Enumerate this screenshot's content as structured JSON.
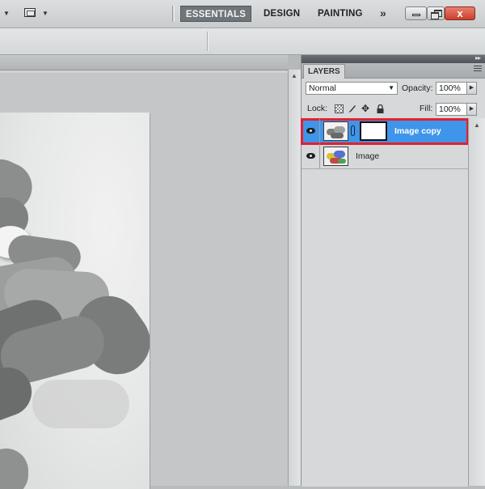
{
  "workspace": {
    "buttons": [
      "ESSENTIALS",
      "DESIGN",
      "PAINTING"
    ],
    "active": "ESSENTIALS",
    "more_symbol": "»"
  },
  "window_controls": {
    "close_symbol": "x"
  },
  "icons": {
    "tool_preset_arrow": "dropdown-arrow",
    "screen_mode": "screen-mode-icon",
    "lock_transparent": "checker-icon",
    "lock_pixels": "brush-icon",
    "lock_position": "move-icon",
    "lock_all": "padlock-icon",
    "visibility": "eye-icon",
    "mask_link": "chain-icon"
  },
  "layers_panel": {
    "tab_label": "LAYERS",
    "blend_mode": "Normal",
    "opacity_label": "Opacity:",
    "opacity_value": "100%",
    "lock_label": "Lock:",
    "fill_label": "Fill:",
    "fill_value": "100%",
    "layers": [
      {
        "name": "Image copy",
        "selected": true,
        "visible": true,
        "has_mask": true
      },
      {
        "name": "Image",
        "selected": false,
        "visible": true,
        "has_mask": false
      }
    ]
  },
  "colors": {
    "selected_layer": "#3f95e9",
    "highlight_box": "#e2202e",
    "active_workspace": "#70757a",
    "close_button": "#d2503c"
  }
}
